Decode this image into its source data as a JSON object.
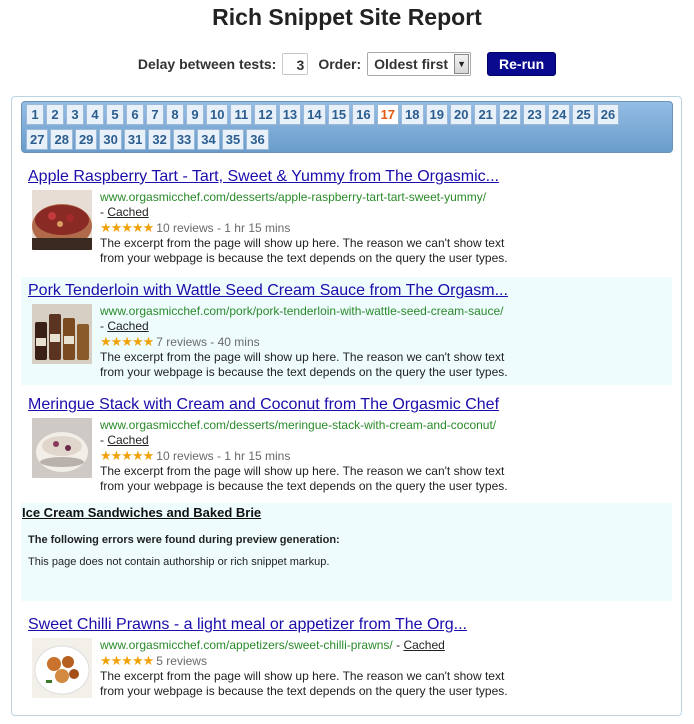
{
  "page": {
    "title": "Rich Snippet Site Report"
  },
  "controls": {
    "delay_label": "Delay between tests:",
    "delay_value": "3",
    "order_label": "Order:",
    "order_selected": "Oldest first",
    "rerun_label": "Re-run"
  },
  "pager": {
    "current": "17",
    "row1": [
      "1",
      "2",
      "3",
      "4",
      "5",
      "6",
      "7",
      "8",
      "9",
      "10",
      "11",
      "12",
      "13",
      "14",
      "15",
      "16",
      "17",
      "18",
      "19",
      "20",
      "21",
      "22",
      "23",
      "24",
      "25",
      "26"
    ],
    "row2": [
      "27",
      "28",
      "29",
      "30",
      "31",
      "32",
      "33",
      "34",
      "35",
      "36"
    ]
  },
  "results": [
    {
      "title": "Apple Raspberry Tart - Tart, Sweet & Yummy from The Orgasmic...",
      "url": "www.orgasmicchef.com/desserts/apple-raspberry-tart-tart-sweet-yummy/",
      "dash": " - ",
      "cached": "Cached",
      "stars": "★★★★★",
      "rating_text": "10 reviews - 1 hr 15 mins",
      "excerpt1": "The excerpt from the page will show up here. The reason we can't show text",
      "excerpt2": "from your webpage is because the text depends on the query the user types."
    },
    {
      "title": "Pork Tenderloin with Wattle Seed Cream Sauce from The Orgasm...",
      "url": "www.orgasmicchef.com/pork/pork-tenderloin-with-wattle-seed-cream-sauce/",
      "dash": " - ",
      "cached": "Cached",
      "stars": "★★★★★",
      "rating_text": "7 reviews - 40 mins",
      "excerpt1": "The excerpt from the page will show up here. The reason we can't show text",
      "excerpt2": "from your webpage is because the text depends on the query the user types."
    },
    {
      "title": "Meringue Stack with Cream and Coconut from The Orgasmic Chef",
      "url": "www.orgasmicchef.com/desserts/meringue-stack-with-cream-and-coconut/",
      "dash": " - ",
      "cached": "Cached",
      "stars": "★★★★★",
      "rating_text": "10 reviews - 1 hr 15 mins",
      "excerpt1": "The excerpt from the page will show up here. The reason we can't show text",
      "excerpt2": "from your webpage is because the text depends on the query the user types."
    },
    {
      "title": "Sweet Chilli Prawns - a light meal or appetizer from The Org...",
      "url": "www.orgasmicchef.com/appetizers/sweet-chilli-prawns/",
      "dash": " - ",
      "cached": "Cached",
      "stars": "★★★★★",
      "rating_text": "5 reviews",
      "excerpt1": "The excerpt from the page will show up here. The reason we can't show text",
      "excerpt2": "from your webpage is because the text depends on the query the user types."
    }
  ],
  "error_item": {
    "title": "Ice Cream Sandwiches and Baked Brie",
    "heading": "The following errors were found during preview generation:",
    "message": "This page does not contain authorship or rich snippet markup."
  },
  "colors": {
    "link": "#1a0dab",
    "url": "#2a8a2a",
    "star": "#f0a20a",
    "button": "#0a0a8f",
    "current_page": "#e55a12"
  }
}
